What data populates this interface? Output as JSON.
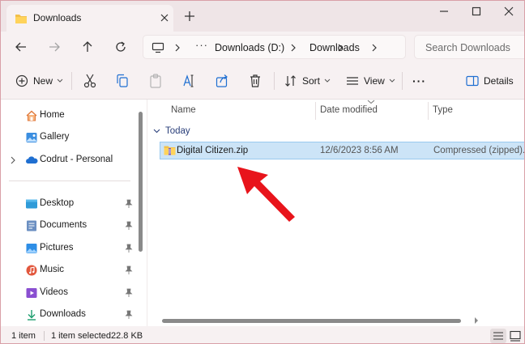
{
  "window": {
    "tab_title": "Downloads",
    "colors": {
      "accent": "#0067c0",
      "selection": "#cce4f7",
      "folder": "#f2c04a",
      "arrow": "#e8141b"
    }
  },
  "address": {
    "crumbs": [
      "Downloads (D:)",
      "Downloads"
    ],
    "overflow": "···",
    "search_placeholder": "Search Downloads"
  },
  "toolbar": {
    "new_label": "New",
    "sort_label": "Sort",
    "view_label": "View",
    "more_label": "···",
    "details_label": "Details"
  },
  "sidebar": {
    "top": [
      {
        "label": "Home",
        "icon": "home-icon"
      },
      {
        "label": "Gallery",
        "icon": "gallery-icon"
      },
      {
        "label": "Codrut - Personal",
        "icon": "onedrive-icon"
      }
    ],
    "pinned": [
      {
        "label": "Desktop",
        "icon": "desktop-icon"
      },
      {
        "label": "Documents",
        "icon": "documents-icon"
      },
      {
        "label": "Pictures",
        "icon": "pictures-icon"
      },
      {
        "label": "Music",
        "icon": "music-icon"
      },
      {
        "label": "Videos",
        "icon": "videos-icon"
      },
      {
        "label": "Downloads",
        "icon": "downloads-icon"
      }
    ]
  },
  "files": {
    "columns": [
      "Name",
      "Date modified",
      "Type"
    ],
    "group": "Today",
    "rows": [
      {
        "name": "Digital Citizen.zip",
        "date": "12/6/2023 8:56 AM",
        "type": "Compressed (zipped)..."
      }
    ]
  },
  "status": {
    "count": "1 item",
    "selected": "1 item selected",
    "size": "22.8 KB"
  }
}
